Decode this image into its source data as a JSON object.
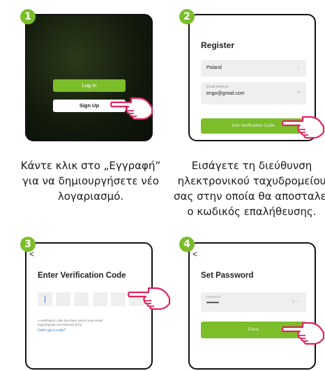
{
  "steps": {
    "s1": {
      "number": "1",
      "caption_lines": [
        "Κάντε κλικ στο „Εγγραφή”",
        "για να δημιουργήσετε νέο",
        "λογαριασμό."
      ]
    },
    "s2": {
      "number": "2",
      "caption_lines": [
        "Εισάγετε τη διεύθυνση",
        "ηλεκτρονικού ταχυδρομείου",
        "σας στην οποία θα αποσταλεί",
        "ο κωδικός επαλήθευσης."
      ]
    },
    "s3": {
      "number": "3"
    },
    "s4": {
      "number": "4"
    }
  },
  "screen1": {
    "login_label": "Log In",
    "signup_label": "Sign Up"
  },
  "screen2": {
    "title": "Register",
    "country_value": "Poland",
    "email_label": "Email Address",
    "email_value": "engo@gmail.com",
    "get_code_label": "Get Verification Code"
  },
  "screen3": {
    "back": "<",
    "title": "Enter Verification Code",
    "info_line1": "A verification code has been sent to your email",
    "info_line2": "engo@gmail.com Resend (57s)",
    "link": "Didn't get a code?"
  },
  "screen4": {
    "back": "<",
    "title": "Set Password",
    "password_label": "Password",
    "password_value": "•••••••••",
    "done_label": "Done"
  },
  "colors": {
    "accent": "#7cbd2a",
    "link": "#3b7fd1"
  }
}
